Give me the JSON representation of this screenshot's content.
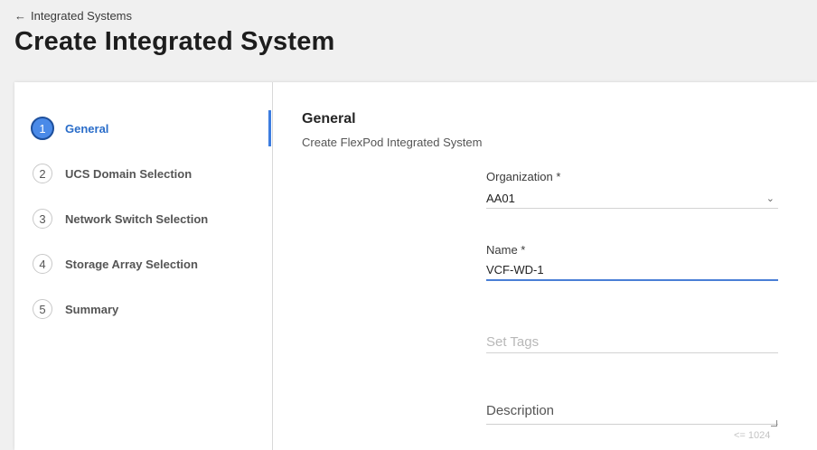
{
  "breadcrumb": {
    "label": "Integrated Systems"
  },
  "page": {
    "title": "Create Integrated System"
  },
  "steps": [
    {
      "number": "1",
      "label": "General",
      "active": true
    },
    {
      "number": "2",
      "label": "UCS Domain Selection",
      "active": false
    },
    {
      "number": "3",
      "label": "Network Switch Selection",
      "active": false
    },
    {
      "number": "4",
      "label": "Storage Array Selection",
      "active": false
    },
    {
      "number": "5",
      "label": "Summary",
      "active": false
    }
  ],
  "section": {
    "title": "General",
    "subtitle": "Create FlexPod Integrated System"
  },
  "form": {
    "organization": {
      "label": "Organization *",
      "value": "AA01"
    },
    "name": {
      "label": "Name *",
      "value": "VCF-WD-1"
    },
    "tags": {
      "placeholder": "Set Tags"
    },
    "description": {
      "placeholder": "Description",
      "limit": "<= 1024"
    }
  },
  "colors": {
    "accent": "#3d7de0",
    "active_step": "#4a8ae8"
  }
}
